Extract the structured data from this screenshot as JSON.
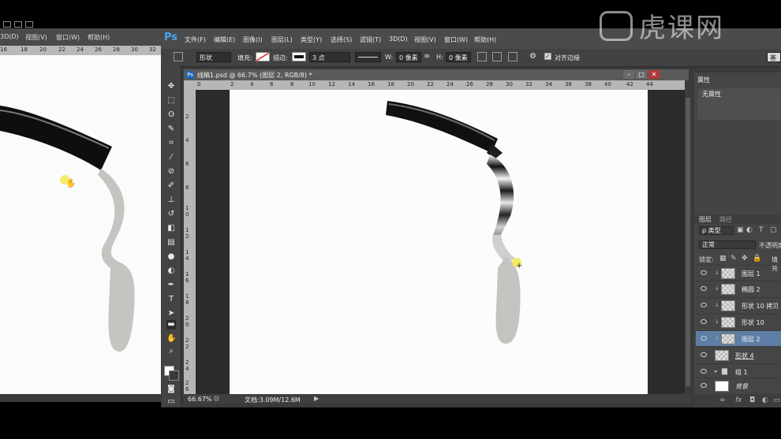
{
  "left_window": {
    "menus": [
      "3D(D)",
      "视图(V)",
      "窗口(W)",
      "帮助(H)"
    ],
    "ruler_ticks": [
      "16",
      "18",
      "20",
      "22",
      "24",
      "26",
      "28",
      "30",
      "32"
    ]
  },
  "app": {
    "logo": "Ps",
    "menus": [
      "文件(F)",
      "编辑(E)",
      "图像(I)",
      "图层(L)",
      "类型(Y)",
      "选择(S)",
      "滤镜(T)",
      "3D(D)",
      "视图(V)",
      "窗口(W)",
      "帮助(H)"
    ]
  },
  "options_bar": {
    "mode": "形状",
    "fill_label": "填充:",
    "stroke_label": "描边:",
    "stroke_size": "3 点",
    "w_label": "W:",
    "w_value": "0 像素",
    "h_label": "H:",
    "h_value": "0 像素",
    "align_edges": "对齐边缘",
    "workspace": "基"
  },
  "document": {
    "icon": "Ps",
    "title": "线稿1.psd @ 66.7% (图层 2, RGB/8) *",
    "zoom": "66.67%",
    "doc_size": "文档:3.09M/12.6M",
    "h_ruler_ticks": [
      "0",
      "2",
      "4",
      "6",
      "8",
      "10",
      "12",
      "14",
      "16",
      "18",
      "20",
      "22",
      "24",
      "26",
      "28",
      "30",
      "32",
      "34",
      "36",
      "38",
      "40",
      "42",
      "44"
    ],
    "v_ruler_ticks": [
      "2",
      "4",
      "6",
      "8",
      "1 0",
      "1 2",
      "1 4",
      "1 6",
      "1 8",
      "2 0",
      "2 2",
      "2 4",
      "2 6"
    ]
  },
  "properties": {
    "tab": "属性",
    "text": "无属性"
  },
  "layers_panel": {
    "tabs": [
      "图层",
      "路径"
    ],
    "kind_filter": "ρ 类型",
    "blend_mode": "正常",
    "opacity_label": "不透明度",
    "lock_label": "锁定:",
    "fill_label": "填充",
    "layers": [
      {
        "name": "图层 1",
        "clipped": true,
        "selected": false,
        "thumb": "checker"
      },
      {
        "name": "椭圆 2",
        "clipped": true,
        "selected": false,
        "thumb": "checker"
      },
      {
        "name": "形状 10 拷贝",
        "clipped": true,
        "selected": false,
        "thumb": "checker"
      },
      {
        "name": "形状 10",
        "clipped": true,
        "selected": false,
        "thumb": "checker"
      },
      {
        "name": "图层 2",
        "clipped": true,
        "selected": true,
        "thumb": "checker"
      },
      {
        "name": "形状 4",
        "clipped": false,
        "selected": false,
        "thumb": "checker"
      },
      {
        "name": "组 1",
        "clipped": false,
        "selected": false,
        "thumb": "folder"
      },
      {
        "name": "背景",
        "clipped": false,
        "selected": false,
        "thumb": "white"
      }
    ],
    "footer_icons": [
      "link-icon",
      "fx-icon",
      "mask-icon",
      "adjustment-icon",
      "folder-icon",
      "new-layer-icon",
      "trash-icon"
    ]
  },
  "watermark": "虎课网"
}
